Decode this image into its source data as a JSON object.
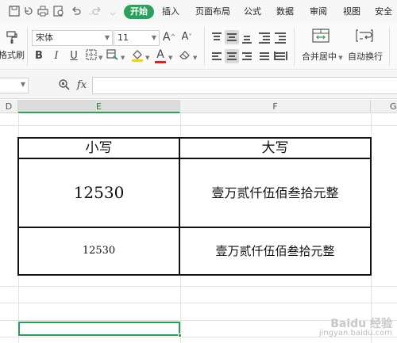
{
  "menubar": {
    "tabs": [
      {
        "label": "开始",
        "active": true
      },
      {
        "label": "插入"
      },
      {
        "label": "页面布局"
      },
      {
        "label": "公式"
      },
      {
        "label": "数据"
      },
      {
        "label": "审阅"
      },
      {
        "label": "视图"
      },
      {
        "label": "安全"
      }
    ],
    "quick_icons": [
      "save-icon",
      "undo-history-icon",
      "print-icon",
      "print-preview-icon",
      "undo-icon",
      "redo-icon",
      "dropdown-icon"
    ]
  },
  "ribbon": {
    "format_painter_label": "格式刷",
    "font_name": "宋体",
    "font_size": "11",
    "grow_font": "A",
    "shrink_font": "A",
    "bold": "B",
    "italic": "I",
    "underline": "U",
    "font_color_letter": "A",
    "merge_center_label": "合并居中",
    "wrap_text_label": "自动换行",
    "accent_color": "#2aa15a"
  },
  "formulabar": {
    "fx_label": "fx",
    "formula_value": ""
  },
  "columns": [
    {
      "label": "D"
    },
    {
      "label": "E",
      "selected": true
    },
    {
      "label": "F"
    },
    {
      "label": "G"
    }
  ],
  "table": {
    "headers": {
      "lower": "小写",
      "upper": "大写"
    },
    "row1": {
      "lower": "12530",
      "upper": "壹万贰仟伍佰叁拾元整"
    },
    "row2": {
      "lower": "12530",
      "upper": "壹万贰仟伍佰叁拾元整"
    }
  },
  "watermark": {
    "main": "Baidu 经验",
    "sub": "jingyan.baidu.com"
  }
}
